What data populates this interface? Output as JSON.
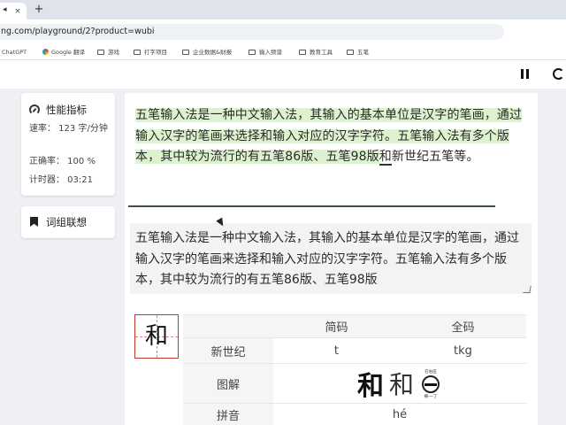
{
  "browser": {
    "tab_label": "\u0003",
    "tab_close": "×",
    "new_tab": "+",
    "url": "ng.com/playground/2?product=wubi",
    "bookmarks": [
      {
        "label": "ChatGPT",
        "type": "link"
      },
      {
        "label": "Google 翻译",
        "type": "google"
      },
      {
        "label": "游戏",
        "type": "folder"
      },
      {
        "label": "打字项目",
        "type": "folder"
      },
      {
        "label": "企业数据&财报",
        "type": "folder"
      },
      {
        "label": "输入频谱",
        "type": "folder"
      },
      {
        "label": "教育工具",
        "type": "folder"
      },
      {
        "label": "五笔",
        "type": "folder"
      }
    ]
  },
  "sidebar": {
    "perf_title": "性能指标",
    "speed": "速率： 123 字/分钟",
    "accuracy": "正确率： 100 %",
    "timer": "计时器： 03:21",
    "words_title": "词组联想"
  },
  "main": {
    "target_highlighted": "五笔输入法是一种中文输入法，其输入的基本单位是汉字的笔画，通过输入汉字的笔画来选择和输入对应的汉字字符。五笔输入法有多个版本，其中较为流行的有五笔86版、五笔98版",
    "target_current": "和",
    "target_rest": "新世纪五笔等。",
    "typed_text": "五笔输入法是一种中文输入法，其输入的基本单位是汉字的笔画，通过输入汉字的笔画来选择和输入对应的汉字字符。五笔输入法有多个版本，其中较为流行的有五笔86版、五笔98版",
    "current_char": "和",
    "table": {
      "headers": [
        "",
        "简码",
        "全码"
      ],
      "rows": [
        {
          "label": "新世纪",
          "short": "t",
          "full": "tkg"
        },
        {
          "label": "图解"
        },
        {
          "label": "拼音",
          "value": "hé"
        }
      ],
      "glyph_1": "和",
      "glyph_2": "和",
      "root_top": "在右區",
      "root_bottom": "横-一丁"
    }
  },
  "colors": {
    "highlight": "#ddf3cf",
    "accent_red": "#c0392b"
  }
}
